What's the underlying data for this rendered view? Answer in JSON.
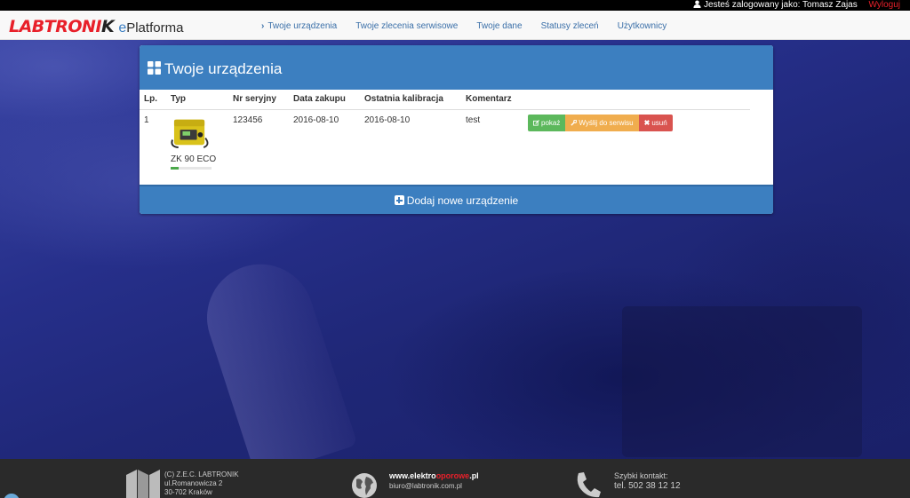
{
  "topbar": {
    "logged_in_prefix": "Jesteś zalogowany jako:",
    "user_name": "Tomasz Zajas",
    "logout": "Wyloguj",
    "icon": "user-icon"
  },
  "brand": {
    "logo_text_red": "LABTRONI",
    "logo_text_dark": "K",
    "platform_e": "e",
    "platform_rest": "Platforma"
  },
  "nav": {
    "active_icon": "chevron-right-icon",
    "items": [
      {
        "label": "Twoje urządzenia"
      },
      {
        "label": "Twoje zlecenia serwisowe"
      },
      {
        "label": "Twoje dane"
      },
      {
        "label": "Statusy zleceń"
      },
      {
        "label": "Użytkownicy"
      }
    ]
  },
  "panel": {
    "title": "Twoje urządzenia",
    "title_icon": "grid-icon",
    "columns": [
      "Lp.",
      "Typ",
      "Nr seryjny",
      "Data zakupu",
      "Ostatnia kalibracja",
      "Komentarz"
    ],
    "rows": [
      {
        "lp": "1",
        "type": "ZK 90 ECO",
        "serial": "123456",
        "purchase_date": "2016-08-10",
        "calibration_date": "2016-08-10",
        "comment": "test",
        "progress": 0.2,
        "actions": {
          "show": "pokaż",
          "send": "Wyślij do serwisu",
          "delete": "usuń"
        }
      }
    ],
    "add_button": "Dodaj nowe urządzenie"
  },
  "footer": {
    "company": {
      "line1": "(C) Z.E.C. LABTRONIK",
      "line2": "ul.Romanowicza 2",
      "line3": "30-702 Kraków",
      "icon": "building-icon"
    },
    "web": {
      "site_prefix": "www.elektro",
      "site_red": "oporowe",
      "site_suffix": ".pl",
      "email": "biuro@labtronik.com.pl",
      "icon": "globe-icon"
    },
    "contact": {
      "label": "Szybki kontakt:",
      "phone": "tel. 502 38 12 12",
      "icon": "phone-icon"
    }
  },
  "colors": {
    "brand_red": "#e8202a",
    "panel_blue": "#3c7fc0",
    "btn_green": "#5cb85c",
    "btn_orange": "#f0ad4e",
    "btn_red": "#d9534f"
  }
}
